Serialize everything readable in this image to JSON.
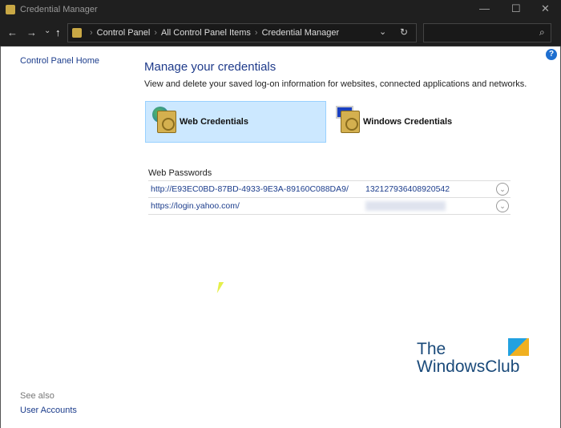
{
  "window": {
    "title": "Credential Manager",
    "minimize": "—",
    "maximize": "☐",
    "close": "✕"
  },
  "nav": {
    "back": "←",
    "forward": "→",
    "recent": "⌄",
    "up": "↑",
    "breadcrumbs": [
      "Control Panel",
      "All Control Panel Items",
      "Credential Manager"
    ],
    "dropdown": "⌄",
    "refresh": "↻",
    "search_placeholder": "",
    "search_icon": "⌕"
  },
  "sidebar": {
    "home": "Control Panel Home",
    "see_also": "See also",
    "user_accounts": "User Accounts"
  },
  "main": {
    "help": "?",
    "title": "Manage your credentials",
    "description": "View and delete your saved log-on information for websites, connected applications and networks.",
    "tiles": [
      {
        "label": "Web Credentials",
        "selected": true
      },
      {
        "label": "Windows Credentials",
        "selected": false
      }
    ],
    "section": "Web Passwords",
    "rows": [
      {
        "url": "http://E93EC0BD-87BD-4933-9E3A-89160C088DA9/",
        "user": "132127936408920542"
      },
      {
        "url": "https://login.yahoo.com/",
        "user": null
      }
    ],
    "expand_icon": "⌄"
  },
  "watermark": {
    "line1": "The",
    "line2": "WindowsClub"
  }
}
